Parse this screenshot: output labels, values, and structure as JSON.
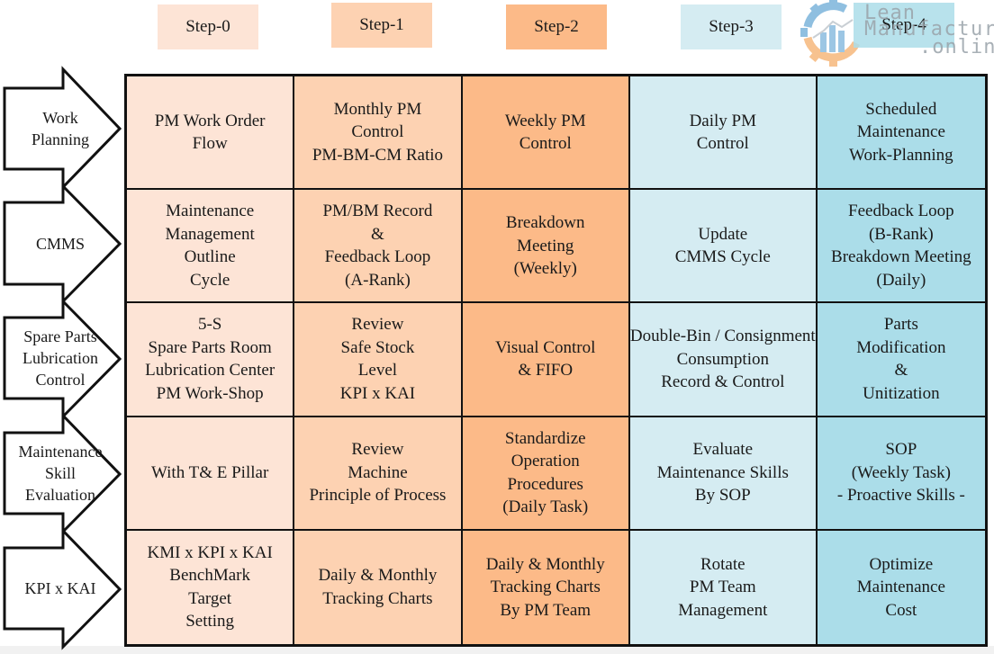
{
  "steps": [
    {
      "label": "Step-0",
      "color": "#fde4d6"
    },
    {
      "label": "Step-1",
      "color": "#fdd2b2"
    },
    {
      "label": "Step-2",
      "color": "#fcba88"
    },
    {
      "label": "Step-3",
      "color": "#d5ecf2"
    },
    {
      "label": "Step-4",
      "color": "#abdde9"
    }
  ],
  "categories": [
    {
      "label": "Work\nPlanning"
    },
    {
      "label": "CMMS"
    },
    {
      "label": "Spare Parts\nLubrication\nControl"
    },
    {
      "label": "Maintenance\nSkill\nEvaluation"
    },
    {
      "label": "KPI x KAI"
    }
  ],
  "matrix": [
    [
      "PM Work Order\nFlow",
      "Monthly PM\nControl\nPM-BM-CM Ratio",
      "Weekly PM\nControl",
      "Daily PM\nControl",
      "Scheduled\nMaintenance\nWork-Planning"
    ],
    [
      "Maintenance\nManagement\nOutline\nCycle",
      "PM/BM Record\n&\nFeedback Loop\n(A-Rank)",
      "Breakdown\nMeeting\n(Weekly)",
      "Update\nCMMS Cycle",
      "Feedback Loop\n(B-Rank)\nBreakdown Meeting\n(Daily)"
    ],
    [
      "5-S\nSpare Parts Room\nLubrication Center\nPM Work-Shop",
      "Review\nSafe Stock\nLevel\nKPI x KAI",
      "Visual Control\n& FIFO",
      "Double-Bin / Consignment\nConsumption\nRecord & Control",
      "Parts\nModification\n&\nUnitization"
    ],
    [
      "With T& E Pillar",
      "Review\nMachine\nPrinciple of Process",
      "Standardize\nOperation\nProcedures\n(Daily Task)",
      "Evaluate\nMaintenance Skills\nBy SOP",
      "SOP\n(Weekly Task)\n- Proactive Skills -"
    ],
    [
      "KMI x KPI x KAI\nBenchMark\nTarget\nSetting",
      "Daily & Monthly\nTracking Charts",
      "Daily & Monthly\nTracking Charts\nBy PM Team",
      "Rotate\nPM Team\nManagement",
      "Optimize\nMaintenance\nCost"
    ]
  ],
  "watermark": {
    "line1": "Lean",
    "line2": "Manufacturing",
    "line3": ".online"
  }
}
